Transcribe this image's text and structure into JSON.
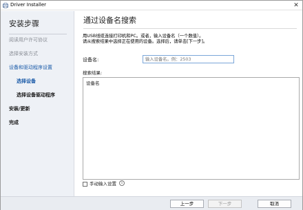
{
  "window": {
    "title": "Driver Installer"
  },
  "sidebar": {
    "title": "安装步骤",
    "steps": [
      {
        "label": "阅读用户许可协议",
        "state": "done"
      },
      {
        "label": "选择安装方式",
        "state": "done"
      },
      {
        "label": "设备和驱动程序设置",
        "state": "current"
      },
      {
        "label": "选择设备",
        "state": "current-sub"
      },
      {
        "label": "选择设备驱动程序",
        "state": "pending-sub"
      },
      {
        "label": "安装/更新",
        "state": "pending"
      },
      {
        "label": "完成",
        "state": "pending"
      }
    ]
  },
  "main": {
    "title": "通过设备名搜索",
    "instructions": [
      "用USB线缆连接打印机和PC。或者，输入设备名（一个数值）。",
      "请从搜索结果中选择正在使用的设备。选择后，请单击[下一步]。"
    ],
    "device_label": "设备名:",
    "device_value": "",
    "device_placeholder": "输入设备名。例：2503",
    "results_label": "搜索结果:",
    "results_column": "设备名",
    "manual_label": "手动输入设置",
    "manual_checked": false
  },
  "footer": {
    "prev_label": "上一步",
    "next_label": "下一步",
    "cancel_label": "取消"
  },
  "icons": {
    "app": "installer-app-icon",
    "close": "close-icon",
    "info": "info-icon"
  }
}
